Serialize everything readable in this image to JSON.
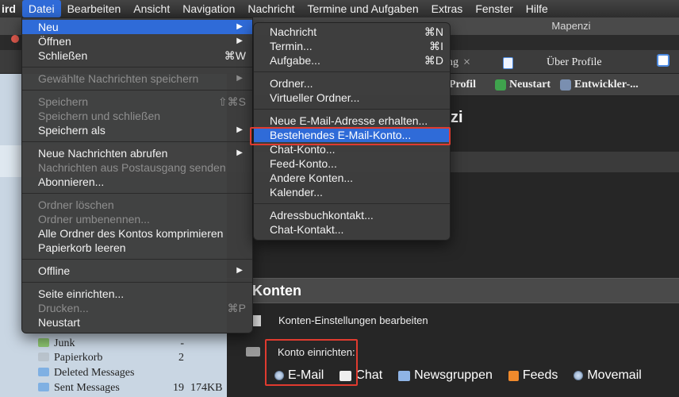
{
  "menubar": {
    "app": "ird",
    "items": [
      "Datei",
      "Bearbeiten",
      "Ansicht",
      "Navigation",
      "Nachricht",
      "Termine und Aufgaben",
      "Extras",
      "Fenster",
      "Hilfe"
    ],
    "active_index": 0
  },
  "window": {
    "title": "Mapenzi",
    "tabs": [
      {
        "label": "ng"
      },
      {
        "label": "Über Profile"
      }
    ],
    "toolbar": [
      "Profil",
      "Neustart",
      "Entwickler-..."
    ],
    "page_title_fragment": "zi"
  },
  "folders": [
    {
      "name": "Junk",
      "count": "-",
      "size": ""
    },
    {
      "name": "Papierkorb",
      "count": "2",
      "size": ""
    },
    {
      "name": "Deleted Messages",
      "count": "",
      "size": ""
    },
    {
      "name": "Sent Messages",
      "count": "19",
      "size": "174KB"
    }
  ],
  "account_central": {
    "section_title": "Konten",
    "settings_link": "Konten-Einstellungen bearbeiten",
    "setup_label": "Konto einrichten:",
    "account_types": [
      "E-Mail",
      "Chat",
      "Newsgruppen",
      "Feeds",
      "Movemail"
    ]
  },
  "datei_menu": {
    "groups": [
      [
        {
          "label": "Neu",
          "shortcut": "",
          "submenu": true,
          "disabled": false,
          "highlight": true
        },
        {
          "label": "Öffnen",
          "shortcut": "",
          "submenu": true,
          "disabled": false
        },
        {
          "label": "Schließen",
          "shortcut": "⌘W",
          "submenu": false,
          "disabled": false
        }
      ],
      [
        {
          "label": "Gewählte Nachrichten speichern",
          "shortcut": "",
          "submenu": true,
          "disabled": true
        }
      ],
      [
        {
          "label": "Speichern",
          "shortcut": "⇧⌘S",
          "submenu": false,
          "disabled": true
        },
        {
          "label": "Speichern und schließen",
          "shortcut": "",
          "submenu": false,
          "disabled": true
        },
        {
          "label": "Speichern als",
          "shortcut": "",
          "submenu": true,
          "disabled": false
        }
      ],
      [
        {
          "label": "Neue Nachrichten abrufen",
          "shortcut": "",
          "submenu": true,
          "disabled": false
        },
        {
          "label": "Nachrichten aus Postausgang senden",
          "shortcut": "",
          "submenu": false,
          "disabled": true
        },
        {
          "label": "Abonnieren...",
          "shortcut": "",
          "submenu": false,
          "disabled": false
        }
      ],
      [
        {
          "label": "Ordner löschen",
          "shortcut": "",
          "submenu": false,
          "disabled": true
        },
        {
          "label": "Ordner umbenennen...",
          "shortcut": "",
          "submenu": false,
          "disabled": true
        },
        {
          "label": "Alle Ordner des Kontos komprimieren",
          "shortcut": "",
          "submenu": false,
          "disabled": false
        },
        {
          "label": "Papierkorb leeren",
          "shortcut": "",
          "submenu": false,
          "disabled": false
        }
      ],
      [
        {
          "label": "Offline",
          "shortcut": "",
          "submenu": true,
          "disabled": false
        }
      ],
      [
        {
          "label": "Seite einrichten...",
          "shortcut": "",
          "submenu": false,
          "disabled": false
        },
        {
          "label": "Drucken...",
          "shortcut": "⌘P",
          "submenu": false,
          "disabled": true
        },
        {
          "label": "Neustart",
          "shortcut": "",
          "submenu": false,
          "disabled": false
        }
      ]
    ]
  },
  "neu_menu": {
    "groups": [
      [
        {
          "label": "Nachricht",
          "shortcut": "⌘N"
        },
        {
          "label": "Termin...",
          "shortcut": "⌘I"
        },
        {
          "label": "Aufgabe...",
          "shortcut": "⌘D"
        }
      ],
      [
        {
          "label": "Ordner...",
          "shortcut": ""
        },
        {
          "label": "Virtueller Ordner...",
          "shortcut": ""
        }
      ],
      [
        {
          "label": "Neue E-Mail-Adresse erhalten...",
          "shortcut": ""
        },
        {
          "label": "Bestehendes E-Mail-Konto...",
          "shortcut": "",
          "highlight": true
        },
        {
          "label": "Chat-Konto...",
          "shortcut": ""
        },
        {
          "label": "Feed-Konto...",
          "shortcut": ""
        },
        {
          "label": "Andere Konten...",
          "shortcut": ""
        },
        {
          "label": "Kalender...",
          "shortcut": ""
        }
      ],
      [
        {
          "label": "Adressbuchkontakt...",
          "shortcut": ""
        },
        {
          "label": "Chat-Kontakt...",
          "shortcut": ""
        }
      ]
    ]
  },
  "colors": {
    "highlight": "#2f6bd8",
    "annotation": "#e03b2f"
  }
}
